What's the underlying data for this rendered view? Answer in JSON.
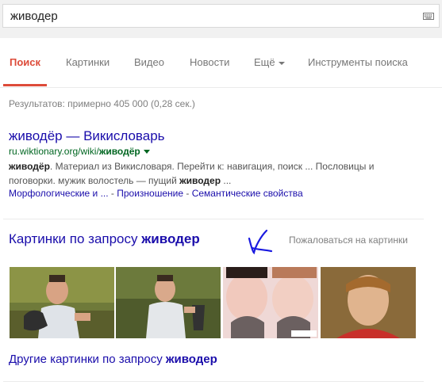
{
  "search": {
    "query": "живодер"
  },
  "tabs": [
    {
      "label": "Поиск"
    },
    {
      "label": "Картинки"
    },
    {
      "label": "Видео"
    },
    {
      "label": "Новости"
    },
    {
      "label": "Ещё"
    },
    {
      "label": "Инструменты поиска"
    }
  ],
  "stats": "Результатов: примерно 405 000 (0,28 сек.)",
  "result": {
    "title": "живодёр — Викисловарь",
    "url_prefix": "ru.wiktionary.org/wiki/",
    "url_bold": "живодёр",
    "snippet_bold_1": "живодёр",
    "snippet_1": ". Материал из Викисловаря. Перейти к: навигация, поиск ... Пословицы и поговорки. мужик волостель — пущий ",
    "snippet_bold_2": "живодер",
    "snippet_2": " ...",
    "sitelinks": [
      "Морфологические и ...",
      "Произношение",
      "Семантические свойства"
    ],
    "sitelink_sep_1": " - ",
    "sitelink_sep_2": " - "
  },
  "images": {
    "header_prefix": "Картинки по запросу ",
    "header_bold": "живодер",
    "report": "Пожаловаться на картинки",
    "more_prefix": "Другие картинки по запросу ",
    "more_bold": "живодер"
  },
  "colors": {
    "link": "#1a0dab",
    "url": "#006621",
    "active_tab": "#dd4b39",
    "annotation": "#1a1ae0"
  },
  "icons": [
    "keyboard-icon",
    "dropdown-caret-icon",
    "checkmark-annotation"
  ]
}
